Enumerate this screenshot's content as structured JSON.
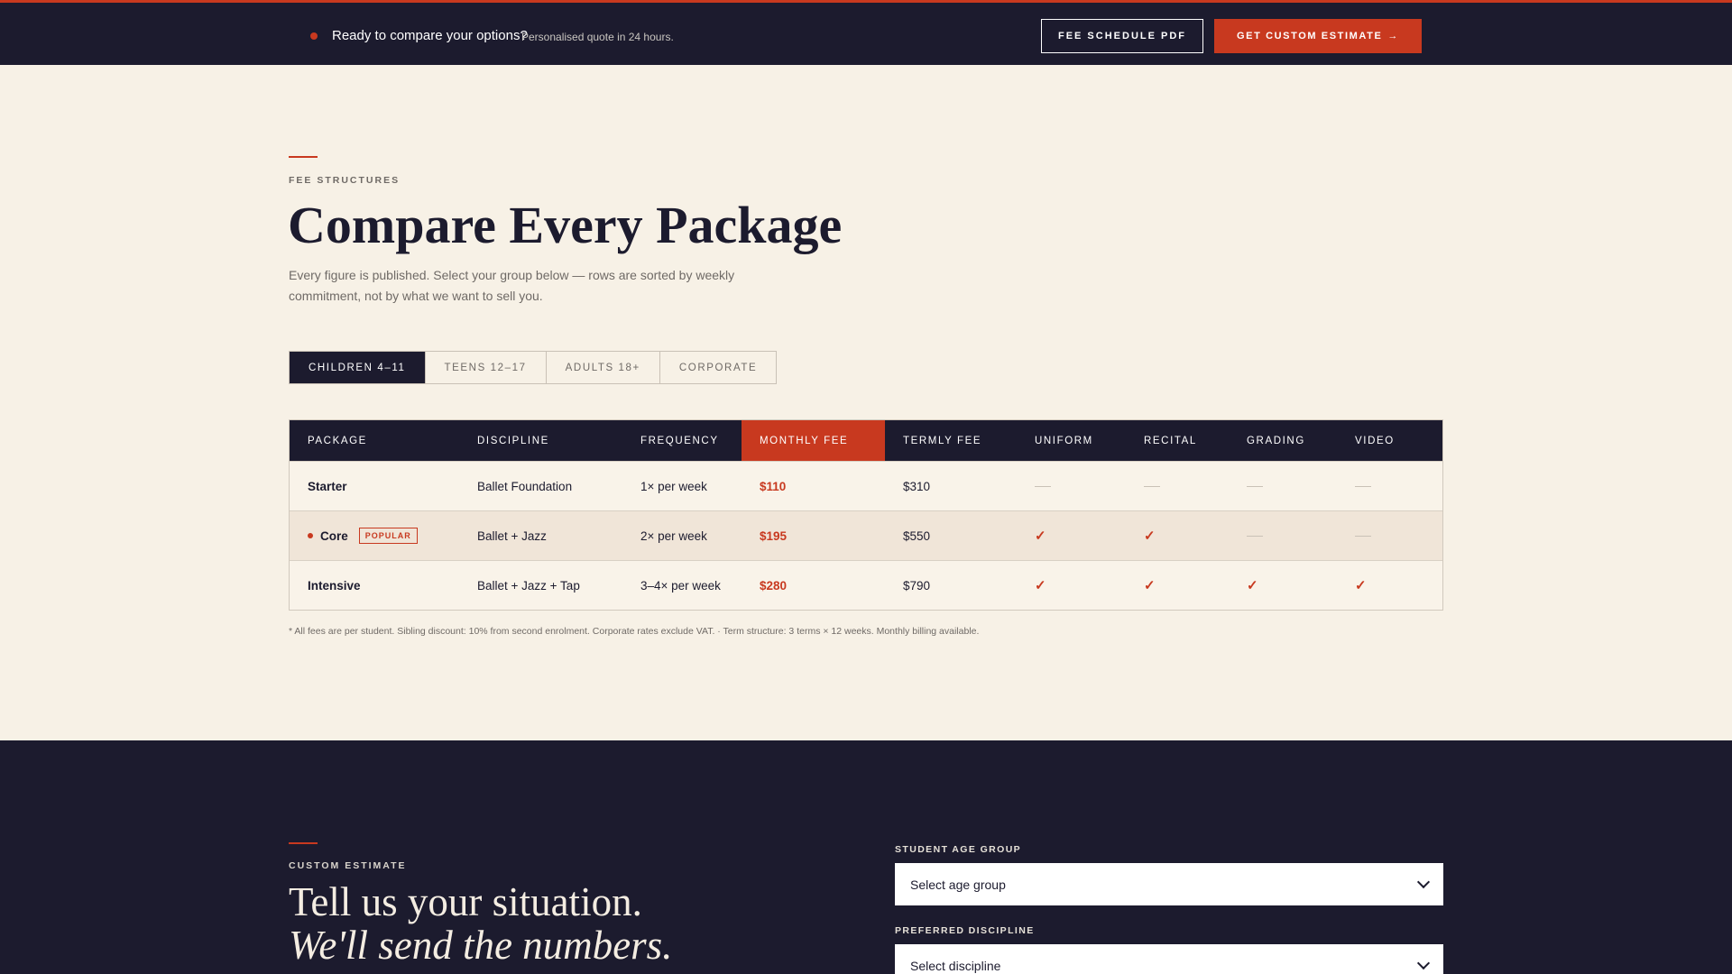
{
  "topbar": {
    "ready": "Ready to compare your options?",
    "sub": "Personalised quote in 24 hours.",
    "pdf_button": "FEE SCHEDULE PDF",
    "estimate_button": "GET CUSTOM ESTIMATE",
    "estimate_arrow": "→"
  },
  "fees": {
    "eyebrow": "FEE STRUCTURES",
    "heading": "Compare Every Package",
    "intro": "Every figure is published. Select your group below — rows are sorted by weekly commitment, not by what we want to sell you.",
    "tabs": [
      "CHILDREN 4–11",
      "TEENS 12–17",
      "ADULTS 18+",
      "CORPORATE"
    ],
    "active_tab": "CHILDREN 4–11",
    "columns": [
      "PACKAGE",
      "DISCIPLINE",
      "FREQUENCY",
      "MONTHLY FEE",
      "TERMLY FEE",
      "UNIFORM",
      "RECITAL",
      "GRADING",
      "VIDEO"
    ],
    "rows": [
      {
        "package": "Starter",
        "discipline": "Ballet Foundation",
        "frequency": "1× per week",
        "monthly": "$110",
        "termly": "$310",
        "uniform": false,
        "recital": false,
        "grading": false,
        "video": false
      },
      {
        "package": "Core",
        "badge": "POPULAR",
        "discipline": "Ballet + Jazz",
        "frequency": "2× per week",
        "monthly": "$195",
        "termly": "$550",
        "uniform": true,
        "recital": true,
        "grading": false,
        "video": false
      },
      {
        "package": "Intensive",
        "discipline": "Ballet + Jazz + Tap",
        "frequency": "3–4× per week",
        "monthly": "$280",
        "termly": "$790",
        "uniform": true,
        "recital": true,
        "grading": true,
        "video": true
      }
    ],
    "check_glyph": "✓",
    "footnote": "* All fees are per student. Sibling discount: 10% from second enrolment. Corporate rates exclude VAT.   ·   Term structure: 3 terms × 12 weeks. Monthly billing available."
  },
  "estimate": {
    "eyebrow": "CUSTOM ESTIMATE",
    "title_line1": "Tell us your situation.",
    "title_line2": "We'll send the numbers.",
    "age_label": "STUDENT AGE GROUP",
    "age_value": "Select age group",
    "discipline_label": "PREFERRED DISCIPLINE",
    "discipline_value": "Select discipline"
  },
  "colors": {
    "navy": "#1c1b2e",
    "accent": "#c8391f",
    "cream": "#f7f1e6"
  }
}
